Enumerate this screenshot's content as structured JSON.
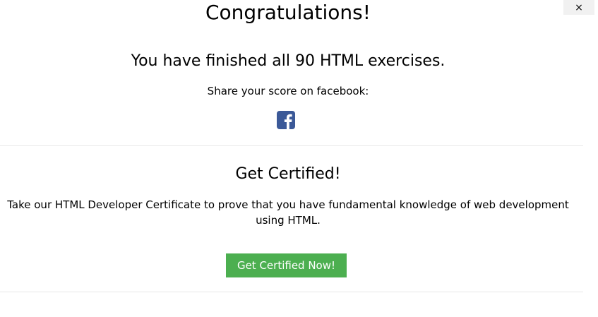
{
  "close_button": {
    "label": "×"
  },
  "congrats": {
    "title": "Congratulations!",
    "message": "You have finished all 90 HTML exercises.",
    "share_text": "Share your score on facebook:"
  },
  "facebook": {
    "icon": "facebook-icon",
    "color": "#3b5998"
  },
  "certificate": {
    "title": "Get Certified!",
    "description": "Take our HTML Developer Certificate to prove that you have fundamental knowledge of web development using HTML.",
    "button_label": "Get Certified Now!",
    "button_color": "#4caf50"
  }
}
